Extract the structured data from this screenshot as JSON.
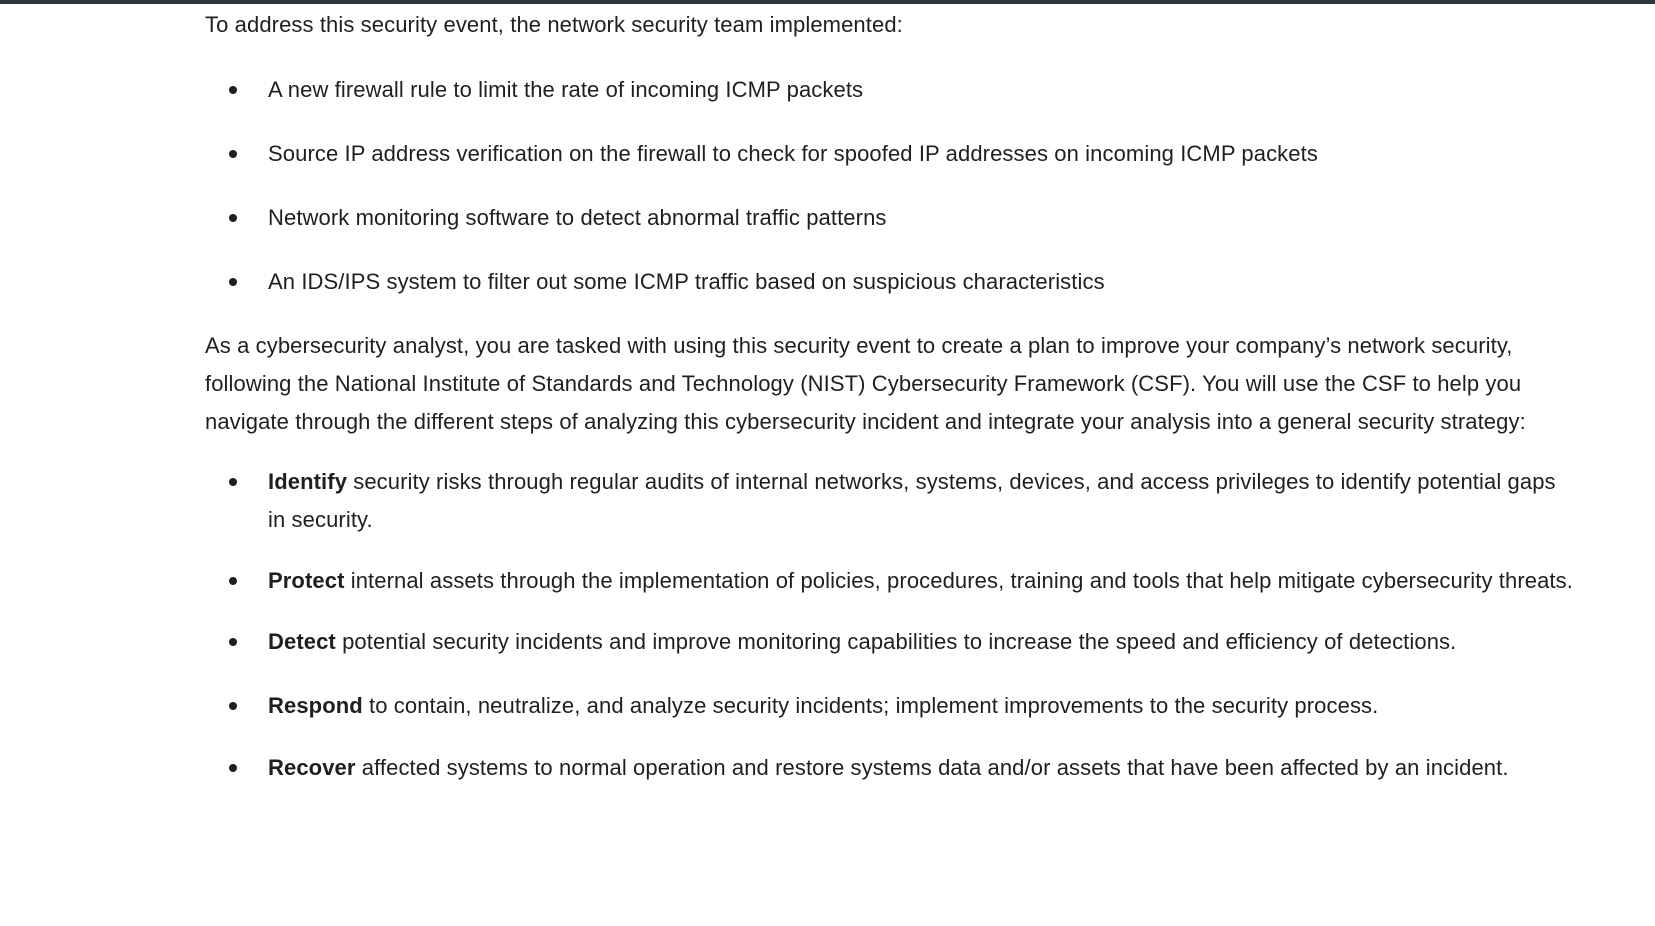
{
  "intro": "To address this security event, the network security team implemented:",
  "measures": [
    "A new firewall rule to limit the rate of incoming ICMP packets",
    "Source IP address verification on the firewall to check for spoofed IP addresses on incoming ICMP packets",
    "Network monitoring software to detect abnormal traffic patterns",
    "An IDS/IPS system to filter out some ICMP traffic based on suspicious characteristics"
  ],
  "task_paragraph": "As a cybersecurity analyst, you are tasked with using this security event to create a plan to improve your company’s network security, following the National Institute of Standards and Technology (NIST) Cybersecurity Framework (CSF). You will use the CSF to help you navigate through the different steps of analyzing this cybersecurity incident and integrate your analysis into a general security strategy:",
  "csf_functions": [
    {
      "term": "Identify",
      "text": " security risks through regular audits of internal networks, systems, devices, and access privileges to identify potential gaps in security."
    },
    {
      "term": "Protect",
      "text": " internal assets through the implementation of policies, procedures, training and tools that help mitigate cybersecurity threats."
    },
    {
      "term": "Detect",
      "text": " potential security incidents and improve monitoring capabilities to increase the speed and efficiency of detections."
    },
    {
      "term": "Respond",
      "text": " to contain, neutralize, and analyze security incidents; implement improvements to the security process."
    },
    {
      "term": "Recover",
      "text": " affected systems to normal operation and restore systems data and/or assets that have been affected by an incident."
    }
  ]
}
